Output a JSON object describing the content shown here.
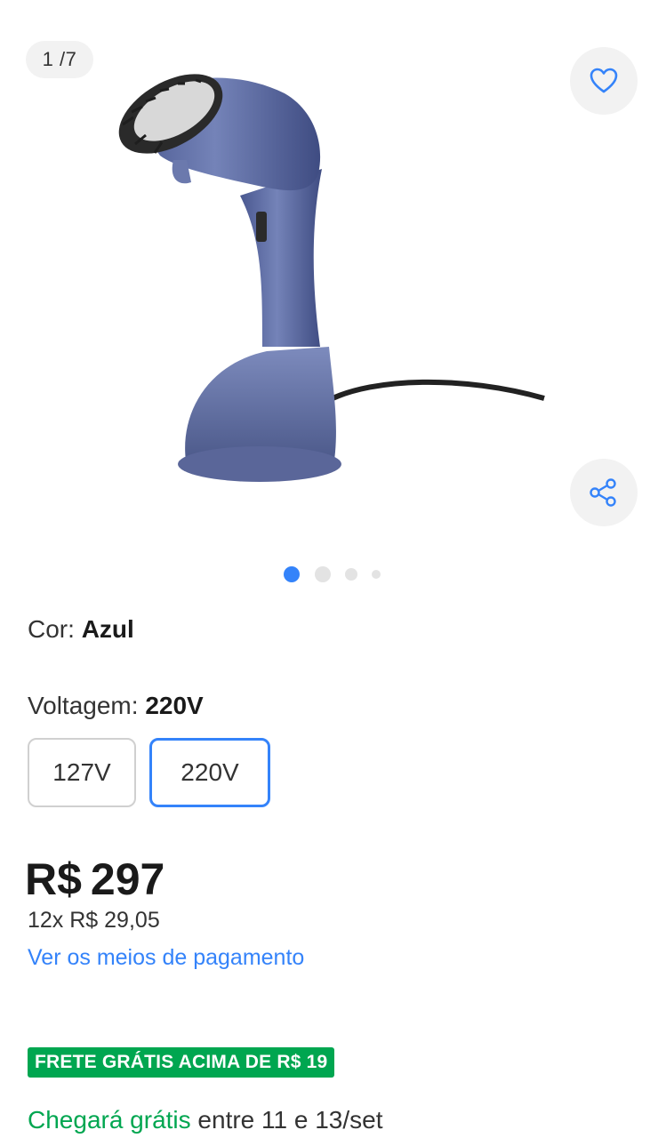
{
  "gallery": {
    "counter": "1 /7",
    "favorite_icon": "heart-icon",
    "share_icon": "share-icon",
    "image": "blue handheld garment steamer",
    "dots_total": 4,
    "dots_active": 1
  },
  "variations": {
    "color_label": "Cor:",
    "color_value": "Azul",
    "voltage_label": "Voltagem:",
    "voltage_value": "220V",
    "options": [
      "127V",
      "220V"
    ],
    "selected": "220V"
  },
  "pricing": {
    "currency": "R$",
    "amount": "297",
    "installments": "12x R$ 29,05",
    "payment_link": "Ver os meios de pagamento"
  },
  "shipping": {
    "badge": "FRETE GRÁTIS ACIMA DE R$ 19",
    "arrival_highlight": "Chegará grátis",
    "arrival_rest": " entre 11 e 13/set"
  },
  "colors": {
    "accent": "#3483fa",
    "green": "#00a650",
    "product": "#5c6ba0"
  }
}
